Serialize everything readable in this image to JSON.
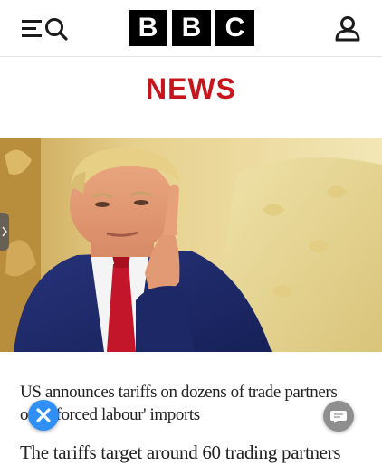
{
  "header": {
    "logo_letters": [
      "B",
      "B",
      "C"
    ],
    "menu_icon": "menu-icon",
    "search_icon": "search-icon",
    "account_icon": "person-icon"
  },
  "section": {
    "title": "NEWS",
    "color": "#c4161c"
  },
  "article": {
    "headline": "US announces tariffs on dozens of trade partners over 'forced labour' imports",
    "body_start": "The tariffs target around 60 trading partners"
  },
  "floating": {
    "close_icon": "close-icon",
    "chat_icon": "chat-icon",
    "close_color": "#2f8ff6"
  }
}
